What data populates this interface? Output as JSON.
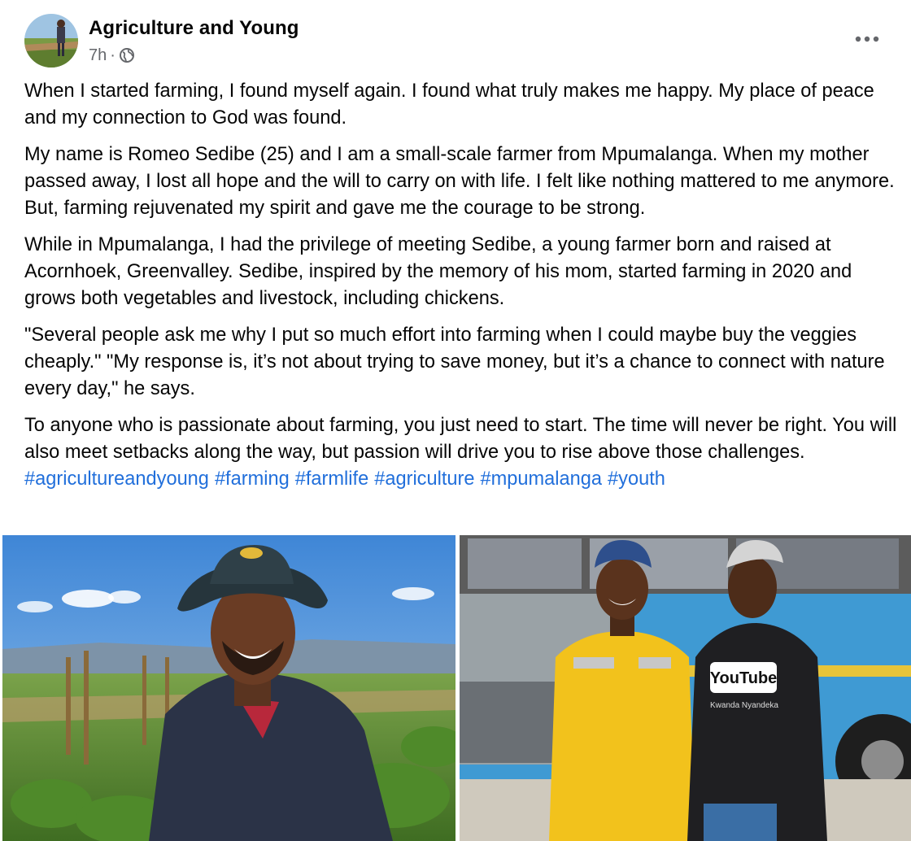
{
  "post": {
    "page_name": "Agriculture and Young",
    "time": "7h",
    "separator": "·",
    "audience_icon": "globe-icon",
    "more_icon": "more-options-icon",
    "paragraphs": [
      "When I started farming, I found myself again. I found what truly makes me happy. My place of peace and my connection to God was found.",
      "My name is Romeo Sedibe (25) and I am a small-scale farmer from Mpumalanga. When my mother passed away, I lost all hope and the will to carry on with life. I felt like nothing mattered to me anymore. But, farming rejuvenated my spirit and gave me the courage to be strong.",
      "While in Mpumalanga, I had the privilege of meeting Sedibe, a young farmer born and raised at Acornhoek, Greenvalley. Sedibe, inspired by the memory of his mom, started farming in 2020 and grows both vegetables and livestock, including chickens.",
      "\"Several people ask me why I put so much effort into farming when I could maybe buy the veggies cheaply.\" \"My response is, it’s not about trying to save money, but it’s a chance to connect with nature every day,\" he says.",
      "To anyone who is passionate about farming, you just need to start. The time will never be right. You will also meet setbacks along the way, but passion will drive you to rise above those challenges."
    ],
    "hashtags": [
      "#agricultureandyoung",
      "#farming",
      "#farmlife",
      "#agriculture",
      "#mpumalanga",
      "#youth"
    ],
    "photo_right": {
      "hoodie_text": "YouTube",
      "hoodie_subtext": "Kwanda Nyandeka"
    }
  },
  "colors": {
    "text": "#050505",
    "secondary": "#65676b",
    "link": "#216fdb",
    "background": "#ffffff"
  }
}
